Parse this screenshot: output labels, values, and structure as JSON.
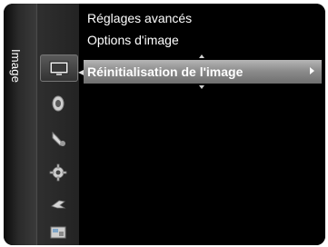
{
  "side_tab": {
    "label": "Image"
  },
  "nav_icons": [
    {
      "name": "picture-icon",
      "selected": true
    },
    {
      "name": "sound-icon",
      "selected": false
    },
    {
      "name": "channel-icon",
      "selected": false
    },
    {
      "name": "setup-icon",
      "selected": false
    },
    {
      "name": "input-icon",
      "selected": false
    },
    {
      "name": "application-icon",
      "selected": false
    }
  ],
  "menu": {
    "items": [
      {
        "label": "Réglages avancés"
      },
      {
        "label": "Options d'image"
      },
      {
        "label": "Réinitialisation de l'image",
        "highlighted": true
      }
    ]
  },
  "colors": {
    "frame": "#000000",
    "highlight_top": "#b6b6b6",
    "highlight_bottom": "#6f6f6f",
    "text": "#ffffff"
  }
}
